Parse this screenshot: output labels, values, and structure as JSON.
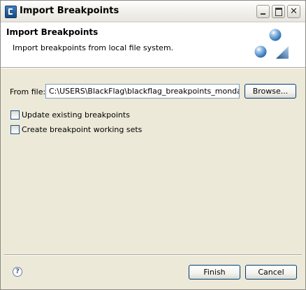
{
  "window": {
    "title": "Import Breakpoints",
    "icon": "app-c-icon",
    "controls": {
      "minimize": "minimize-icon",
      "maximize": "maximize-icon",
      "close": "close-icon",
      "close_glyph": "✕"
    }
  },
  "header": {
    "title": "Import Breakpoints",
    "description": "Import breakpoints from local file system.",
    "art": "breakpoints-wizard-icon"
  },
  "form": {
    "from_file_label": "From file:",
    "from_file_value": "C:\\USERS\\BlackFlag\\blackflag_breakpoints_monday.bkp",
    "browse_label": "Browse...",
    "options": [
      {
        "label": "Update existing breakpoints",
        "checked": false
      },
      {
        "label": "Create breakpoint working sets",
        "checked": false
      }
    ]
  },
  "footer": {
    "help_glyph": "?",
    "finish_label": "Finish",
    "cancel_label": "Cancel"
  }
}
